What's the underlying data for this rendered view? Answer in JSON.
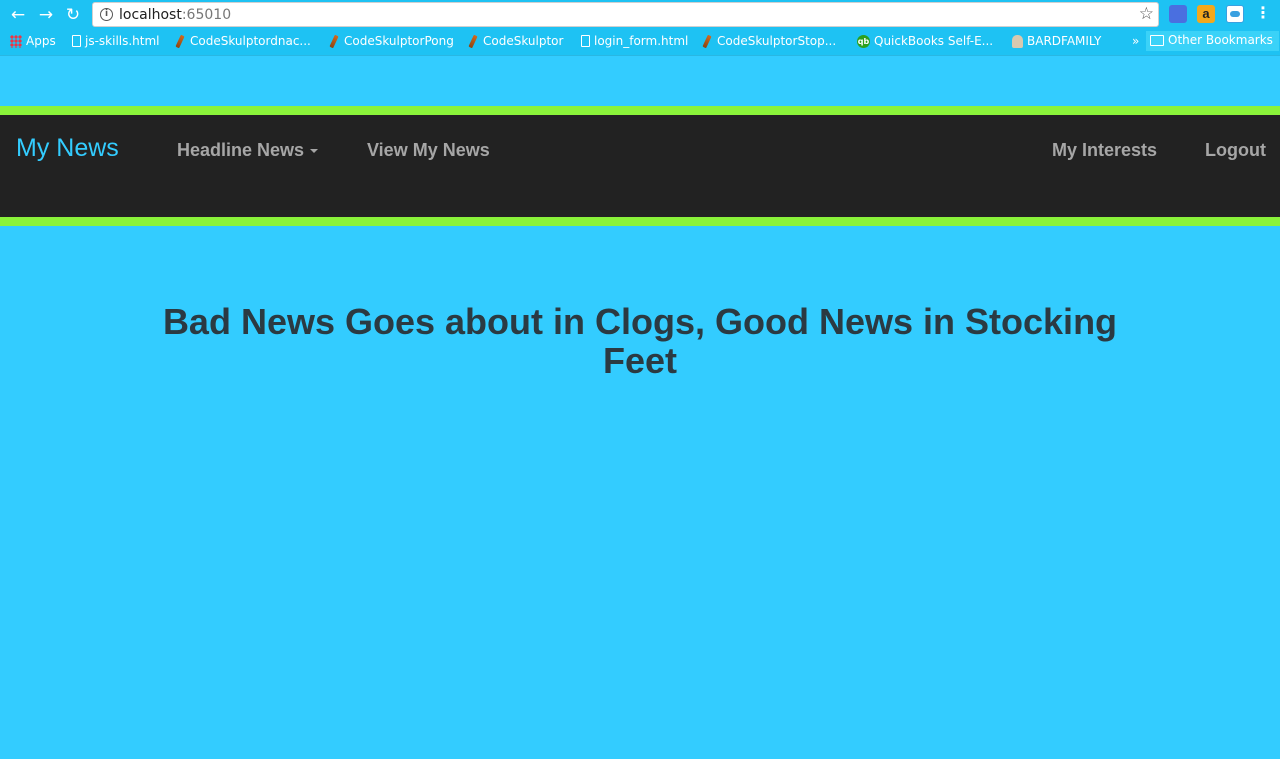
{
  "browser": {
    "url_host": "localhost",
    "url_port": ":65010",
    "bookmarks": [
      {
        "label": "Apps",
        "icon": "apps-grid-icon"
      },
      {
        "label": "js-skills.html",
        "icon": "page-icon"
      },
      {
        "label": "CodeSkulptordnac...",
        "icon": "wand-icon"
      },
      {
        "label": "CodeSkulptorPong",
        "icon": "wand-icon"
      },
      {
        "label": "CodeSkulptor",
        "icon": "wand-icon"
      },
      {
        "label": "login_form.html",
        "icon": "page-icon"
      },
      {
        "label": "CodeSkulptorStop...",
        "icon": "wand-icon"
      },
      {
        "label": "QuickBooks Self-E...",
        "icon": "quickbooks-icon"
      },
      {
        "label": "BARDFAMILY",
        "icon": "family-icon"
      }
    ],
    "more_label": "»",
    "other_bookmarks": "Other Bookmarks",
    "extension_amazon_glyph": "a"
  },
  "nav": {
    "brand": "My News",
    "headline_news": "Headline News",
    "view_my_news": "View My News",
    "my_interests": "My Interests",
    "logout": "Logout"
  },
  "main": {
    "headline": "Bad News Goes about in Clogs, Good News in Stocking Feet"
  },
  "colors": {
    "page_background": "#33ccff",
    "navbar_background": "#222222",
    "navbar_border": "#8af33a",
    "brand": "#33ccff",
    "nav_link": "#a6a6a6",
    "headline": "#2b3a42"
  }
}
